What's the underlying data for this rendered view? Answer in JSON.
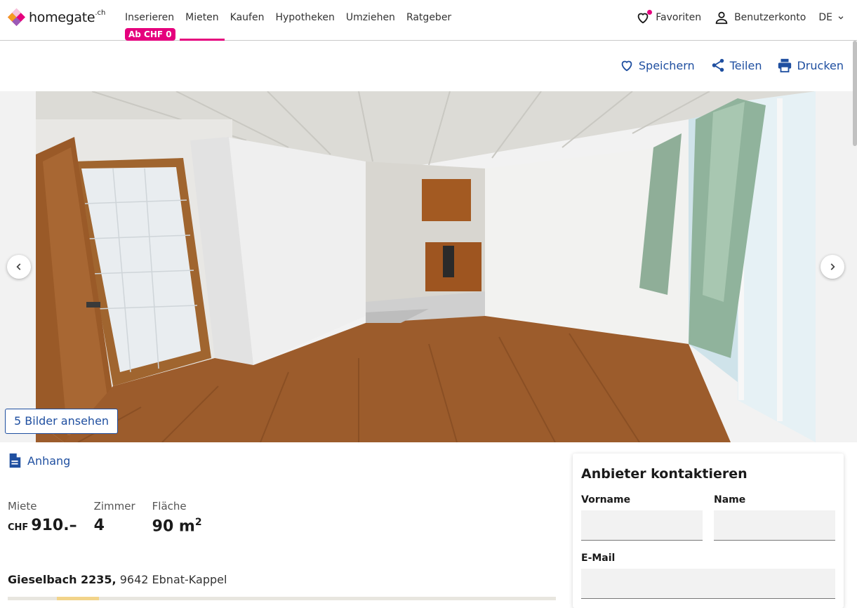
{
  "brand": {
    "name": "homegate",
    "suffix": ".ch"
  },
  "nav": {
    "links": [
      {
        "label": "Inserieren"
      },
      {
        "label": "Mieten"
      },
      {
        "label": "Kaufen"
      },
      {
        "label": "Hypotheken"
      },
      {
        "label": "Umziehen"
      },
      {
        "label": "Ratgeber"
      }
    ],
    "promo_badge": "Ab CHF 0",
    "favorites": "Favoriten",
    "account": "Benutzerkonto",
    "language": "DE"
  },
  "actions": {
    "save": "Speichern",
    "share": "Teilen",
    "print": "Drucken"
  },
  "gallery": {
    "view_images_button": "5 Bilder ansehen"
  },
  "listing": {
    "attachment_label": "Anhang",
    "facts": [
      {
        "label": "Miete",
        "currency": "CHF",
        "value": "910.–"
      },
      {
        "label": "Zimmer",
        "value": "4"
      },
      {
        "label": "Fläche",
        "value": "90 m",
        "unit_sup": "2"
      }
    ],
    "address_street": "Gieselbach 2235,",
    "address_city": "9642 Ebnat-Kappel"
  },
  "contact": {
    "title": "Anbieter kontaktieren",
    "first_name_label": "Vorname",
    "first_name_value": "",
    "last_name_label": "Name",
    "last_name_value": "",
    "email_label": "E-Mail",
    "email_value": ""
  },
  "colors": {
    "accent": "#e5007d",
    "link": "#1f4fa0"
  }
}
